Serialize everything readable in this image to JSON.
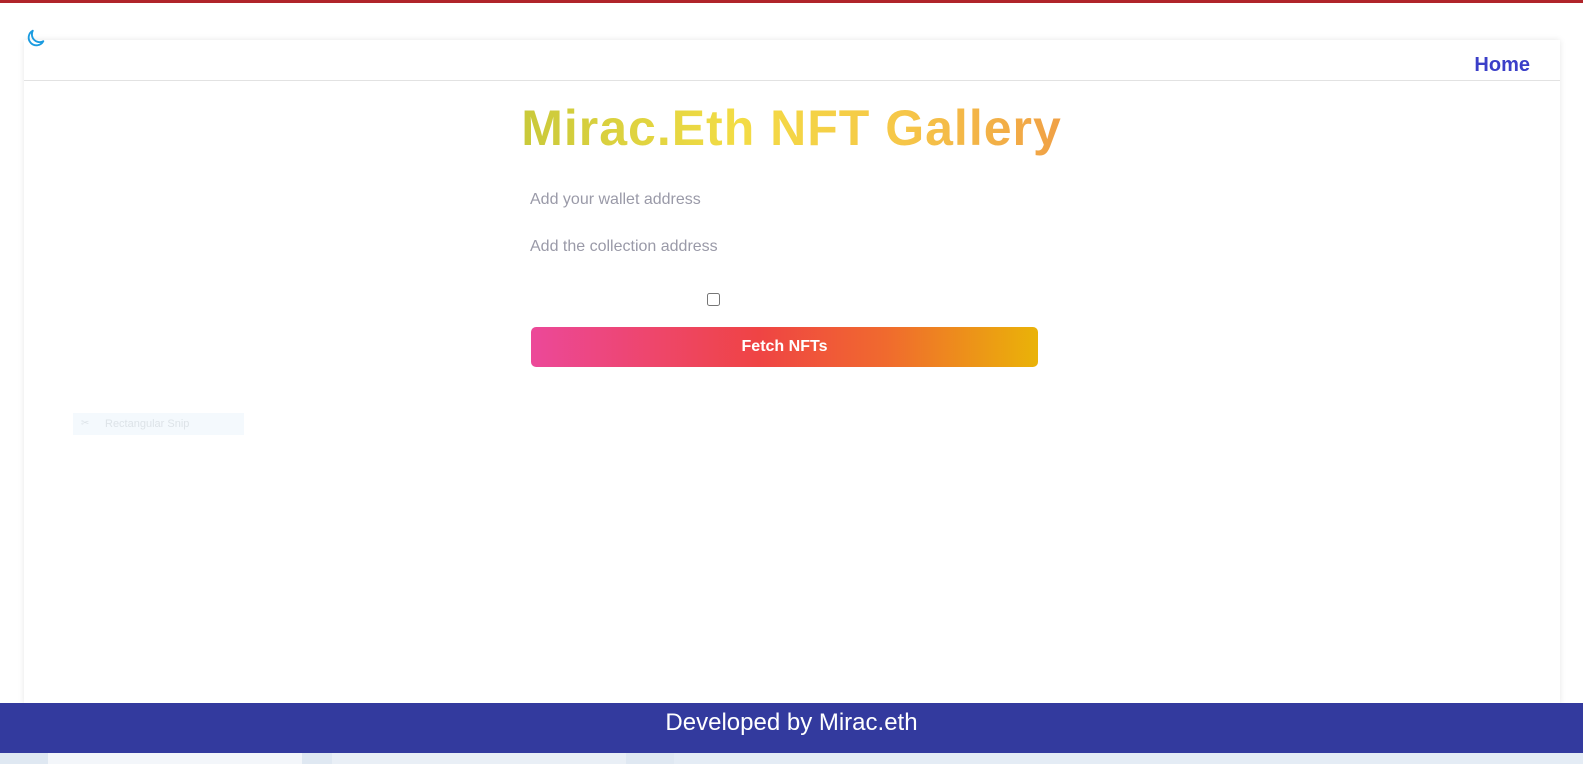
{
  "header": {
    "theme_toggle_icon": "moon-icon",
    "nav_home_label": "Home"
  },
  "main": {
    "title": "Mirac.Eth NFT Gallery",
    "wallet_placeholder": "Add your wallet address",
    "wallet_value": "",
    "collection_placeholder": "Add the collection address",
    "collection_value": "",
    "checkbox_checked": false,
    "fetch_button_label": "Fetch NFTs"
  },
  "overlay": {
    "snip_label": "Rectangular Snip",
    "snip_icon": "scissors-icon"
  },
  "footer": {
    "text": "Developed by Mirac.eth"
  },
  "colors": {
    "top_accent": "#b0242a",
    "nav_link": "#3b3fc8",
    "footer_bg": "#333a9e",
    "moon": "#1a9be0"
  }
}
